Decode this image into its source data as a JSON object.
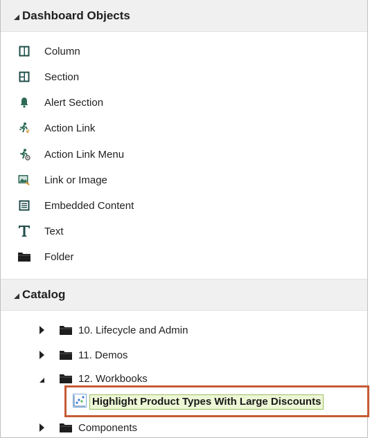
{
  "dashboard_objects": {
    "title": "Dashboard Objects",
    "items": [
      {
        "label": "Column",
        "icon": "column-icon"
      },
      {
        "label": "Section",
        "icon": "section-icon"
      },
      {
        "label": "Alert Section",
        "icon": "bell-icon"
      },
      {
        "label": "Action Link",
        "icon": "action-link-icon"
      },
      {
        "label": "Action Link Menu",
        "icon": "action-link-menu-icon"
      },
      {
        "label": "Link or Image",
        "icon": "link-image-icon"
      },
      {
        "label": "Embedded Content",
        "icon": "embedded-content-icon"
      },
      {
        "label": "Text",
        "icon": "text-icon"
      },
      {
        "label": "Folder",
        "icon": "folder-icon"
      }
    ]
  },
  "catalog": {
    "title": "Catalog",
    "items": [
      {
        "label": "10. Lifecycle and Admin",
        "state": "collapsed"
      },
      {
        "label": "11. Demos",
        "state": "collapsed"
      },
      {
        "label": "12. Workbooks",
        "state": "expanded"
      },
      {
        "label": "Highlight Product Types With Large Discounts",
        "state": "selected",
        "icon": "workbook-chart-icon"
      },
      {
        "label": "Components",
        "state": "collapsed"
      }
    ]
  },
  "colors": {
    "highlight_border": "#c65a36",
    "selected_bg": "#edf7d6",
    "header_bg": "#f0f0f0"
  }
}
